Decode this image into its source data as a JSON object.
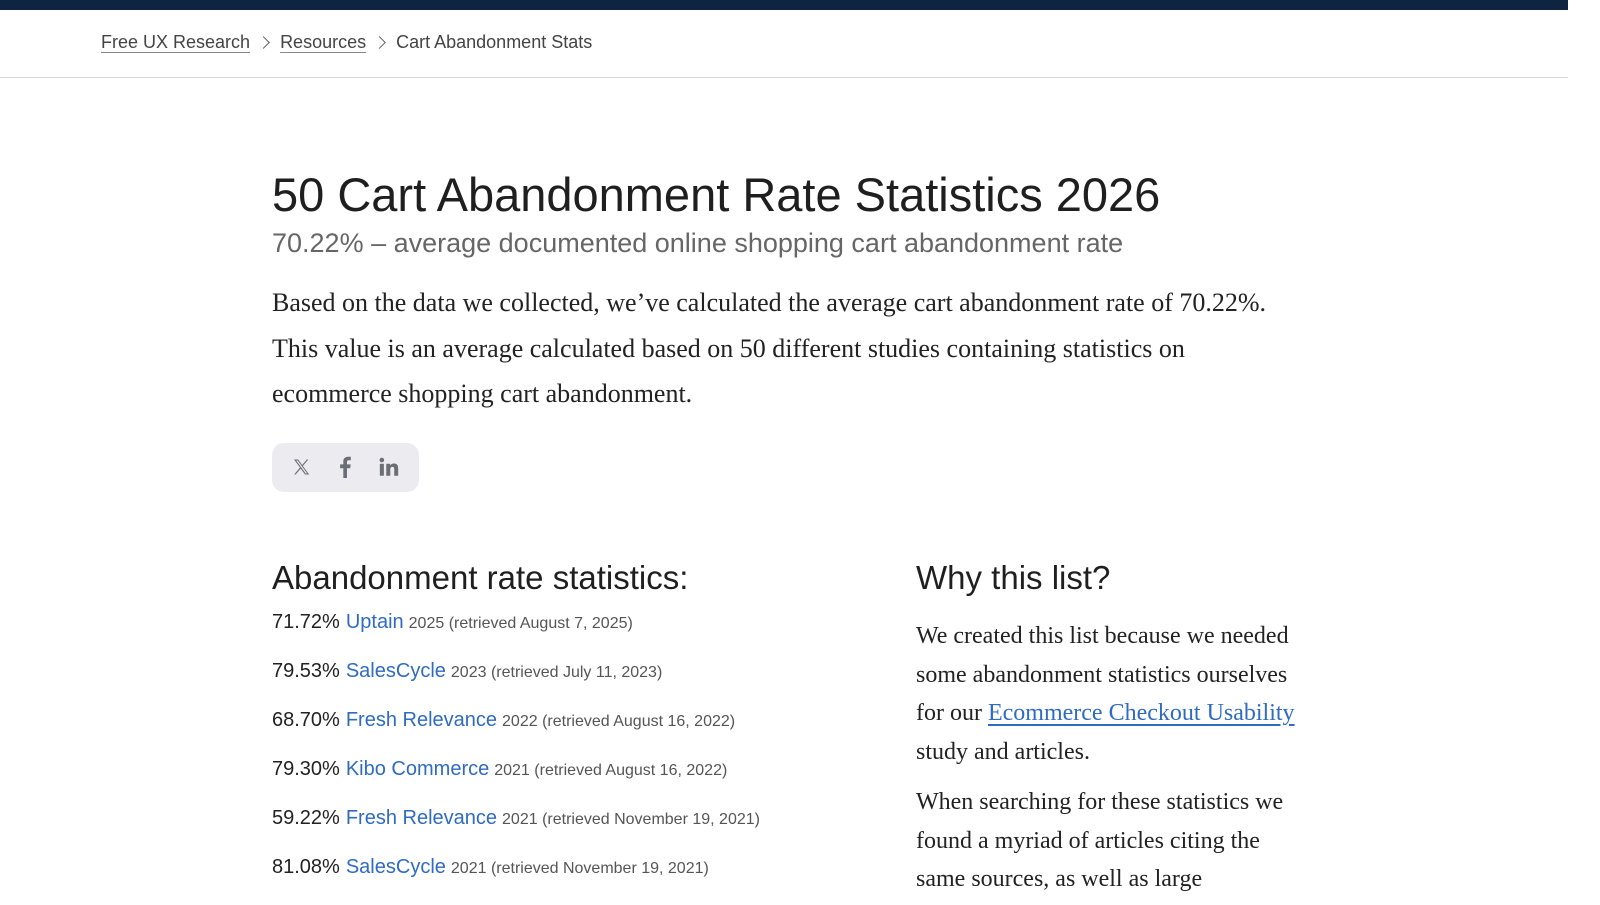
{
  "breadcrumb": {
    "items": [
      {
        "label": "Free UX Research"
      },
      {
        "label": "Resources"
      }
    ],
    "current": "Cart Abandonment Stats"
  },
  "article": {
    "title": "50 Cart Abandonment Rate Statistics 2026",
    "subtitle": "70.22% – average documented online shopping cart abandonment rate",
    "intro": "Based on the data we collected, we’ve calculated the average cart abandonment rate of 70.22%. This value is an average calculated based on 50 different studies containing statistics on ecommerce shopping cart abandonment."
  },
  "share": {
    "icons": [
      "x-icon",
      "facebook-icon",
      "linkedin-icon"
    ]
  },
  "stats": {
    "heading": "Abandonment rate statistics:",
    "rows": [
      {
        "rate": "71.72%",
        "source": "Uptain",
        "year": "2025",
        "retrieved": "(retrieved August 7, 2025)"
      },
      {
        "rate": "79.53%",
        "source": "SalesCycle",
        "year": "2023",
        "retrieved": "(retrieved July 11, 2023)"
      },
      {
        "rate": "68.70%",
        "source": "Fresh Relevance",
        "year": "2022",
        "retrieved": "(retrieved August 16, 2022)"
      },
      {
        "rate": "79.30%",
        "source": "Kibo Commerce",
        "year": "2021",
        "retrieved": "(retrieved August 16, 2022)"
      },
      {
        "rate": "59.22%",
        "source": "Fresh Relevance",
        "year": "2021",
        "retrieved": "(retrieved November 19, 2021)"
      },
      {
        "rate": "81.08%",
        "source": "SalesCycle",
        "year": "2021",
        "retrieved": "(retrieved November 19, 2021)"
      }
    ]
  },
  "why": {
    "heading": "Why this list?",
    "p1_before": "We created this list because we needed some abandonment statistics ourselves for our ",
    "p1_link": "Ecommerce Checkout Usability",
    "p1_after": " study and articles.",
    "p2": "When searching for these statistics we found a myriad of articles citing the same sources, as well as large"
  },
  "colors": {
    "topbar": "#0f2440",
    "link": "#2f6bc2",
    "share_bg": "#ececf0"
  }
}
